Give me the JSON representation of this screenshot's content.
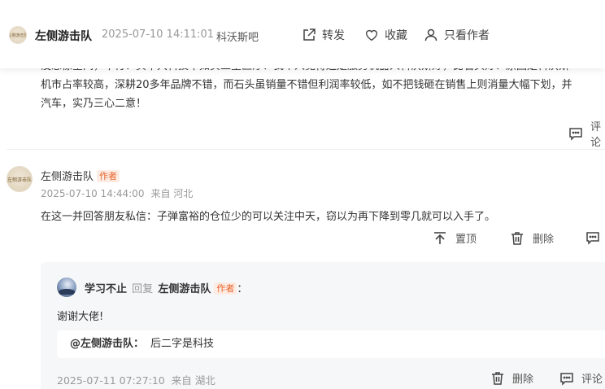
{
  "header": {
    "author": "左侧游击队",
    "time": "2025-07-10 14:11:01",
    "bar_name": "科沃斯吧",
    "avatar_text": "左侧游击队",
    "actions": {
      "share": "转发",
      "favorite": "收藏",
      "only_author": "只看作者"
    }
  },
  "prev_comment": {
    "lines": [
      "没想像空间，不行！买中大科技不如买三星医疗！我个人觉得还是服务机器人科沃斯好，比石头好！原因是科沃斯",
      "机市占率较高，深耕20多年品牌不错，而石头虽销量不错但利润率较低，如不把钱砸在销售上则消量大幅下划，并",
      "汽车，实乃三心二意！"
    ],
    "reply_label": "评论"
  },
  "comment": {
    "avatar_text": "左侧游击队",
    "author": "左侧游击队",
    "author_badge": "作者",
    "time": "2025-07-10 14:44:00",
    "location": "来自 河北",
    "text": "在这一并回答朋友私信：子弹富裕的仓位少的可以关注中天，窃以为再下降到零几就可以入手了。",
    "actions": {
      "pin": "置顶",
      "delete": "删除"
    }
  },
  "reply": {
    "author": "学习不止",
    "reply_word": "回复",
    "target": "左侧游击队",
    "target_badge": "作者",
    "colon": "：",
    "text": "谢谢大佬!",
    "quote": {
      "name": "@左侧游击队：",
      "text": "后二字是科技"
    },
    "time": "2025-07-11 07:27:10",
    "location": "来自 湖北",
    "actions": {
      "delete": "删除",
      "reply": "评论"
    }
  },
  "colors": {
    "badge_text": "#e8642c",
    "badge_bg": "#fdece3",
    "meta_gray": "#999999",
    "reply_bg": "#f6f7f8"
  }
}
